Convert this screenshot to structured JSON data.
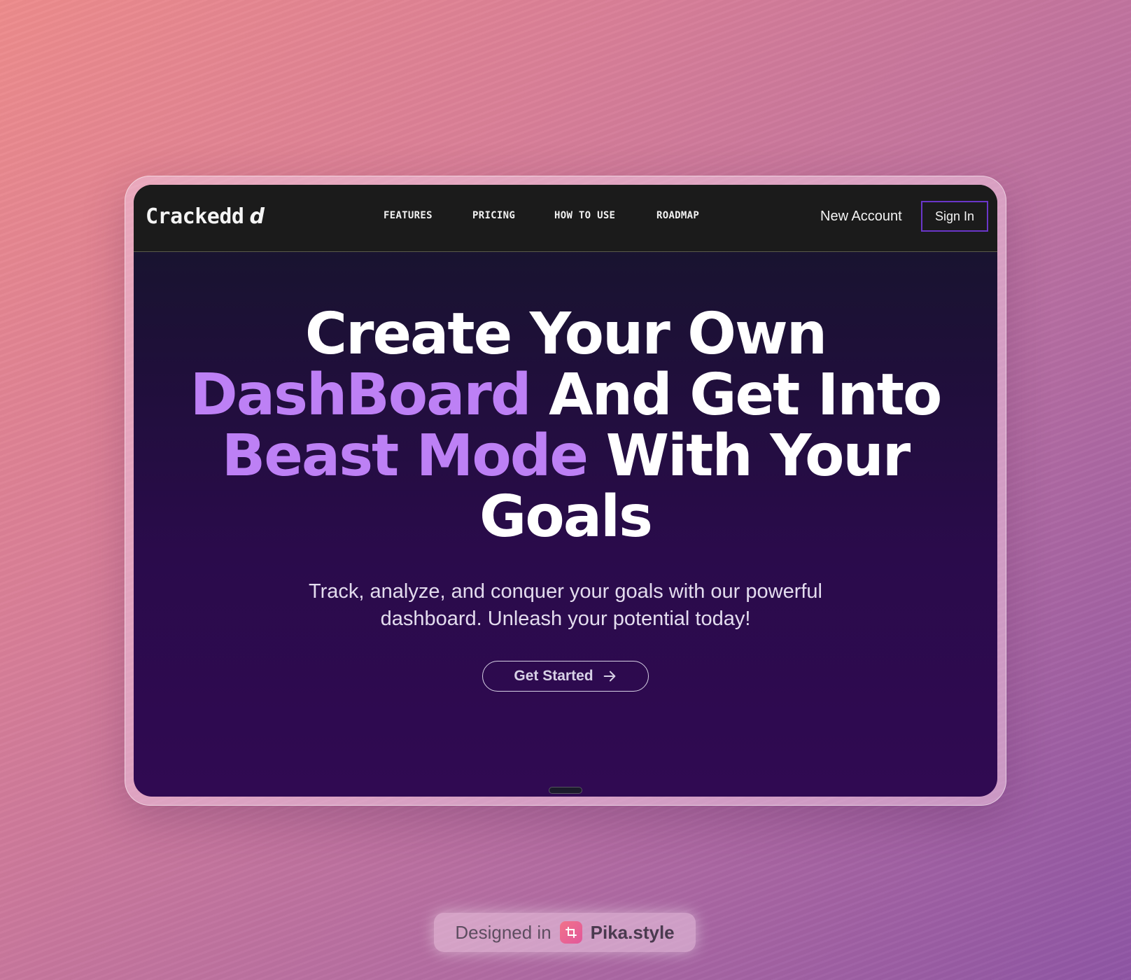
{
  "nav": {
    "logo_text": "Crackedd",
    "logo_mark": "d",
    "links": [
      "FEATURES",
      "PRICING",
      "HOW TO USE",
      "ROADMAP"
    ],
    "new_account_label": "New Account",
    "sign_in_label": "Sign In"
  },
  "hero": {
    "title_line1": "Create Your Own",
    "title_accent1": "DashBoard",
    "title_line2_rest": "And Get Into",
    "title_accent2": "Beast Mode",
    "title_line3_rest": "With Your",
    "title_line4": "Goals",
    "subtitle": "Track, analyze, and conquer your goals with our powerful dashboard. Unleash your potential today!",
    "cta_label": "Get Started"
  },
  "watermark": {
    "prefix": "Designed in",
    "brand": "Pika.style"
  },
  "colors": {
    "accent": "#bd80f5",
    "nav_bg": "#1b1b1b",
    "sign_in_border": "#6a36c9",
    "hero_bottom": "#300a52"
  },
  "icons": [
    "arrow-right-icon",
    "pika-logo-icon"
  ]
}
